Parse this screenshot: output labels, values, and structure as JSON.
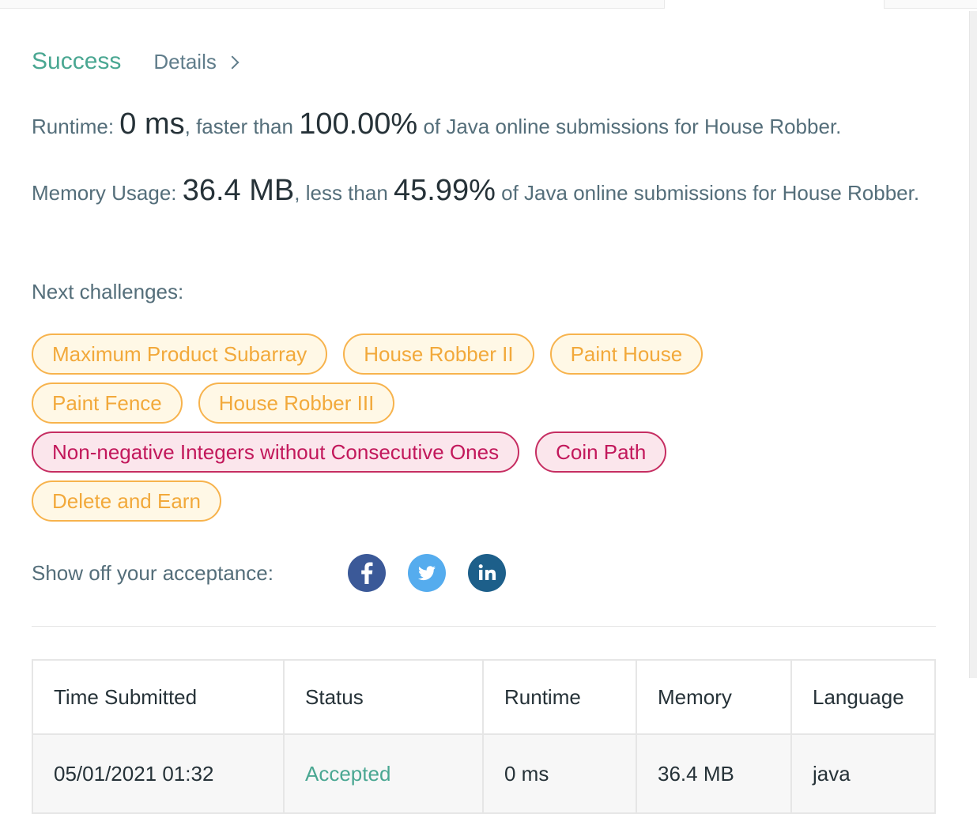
{
  "result": {
    "status": "Success",
    "details_label": "Details",
    "status_color": "#4aa792"
  },
  "runtime": {
    "label": "Runtime:",
    "value": "0 ms",
    "compare": ", faster than",
    "percent": "100.00%",
    "suffix": "of Java online submissions for House Robber."
  },
  "memory": {
    "label": "Memory Usage:",
    "value": "36.4 MB",
    "compare": ", less than",
    "percent": "45.99%",
    "suffix": "of Java online submissions for House Robber."
  },
  "next": {
    "label": "Next challenges:",
    "rows": [
      [
        {
          "label": "Maximum Product Subarray",
          "difficulty": "medium"
        },
        {
          "label": "House Robber II",
          "difficulty": "medium"
        },
        {
          "label": "Paint House",
          "difficulty": "medium"
        }
      ],
      [
        {
          "label": "Paint Fence",
          "difficulty": "medium"
        },
        {
          "label": "House Robber III",
          "difficulty": "medium"
        }
      ],
      [
        {
          "label": "Non-negative Integers without Consecutive Ones",
          "difficulty": "hard"
        },
        {
          "label": "Coin Path",
          "difficulty": "hard"
        }
      ],
      [
        {
          "label": "Delete and Earn",
          "difficulty": "medium"
        }
      ]
    ]
  },
  "share": {
    "label": "Show off your acceptance:",
    "icons": [
      "facebook-icon",
      "twitter-icon",
      "linkedin-icon"
    ]
  },
  "table": {
    "headers": [
      "Time Submitted",
      "Status",
      "Runtime",
      "Memory",
      "Language"
    ],
    "rows": [
      {
        "time": "05/01/2021 01:32",
        "status": "Accepted",
        "runtime": "0 ms",
        "memory": "36.4 MB",
        "language": "java"
      }
    ]
  },
  "colors": {
    "medium": "#f7b34d",
    "hard": "#c62e62",
    "facebook": "#3b5998",
    "twitter": "#55acee",
    "linkedin": "#1d5f8a"
  }
}
